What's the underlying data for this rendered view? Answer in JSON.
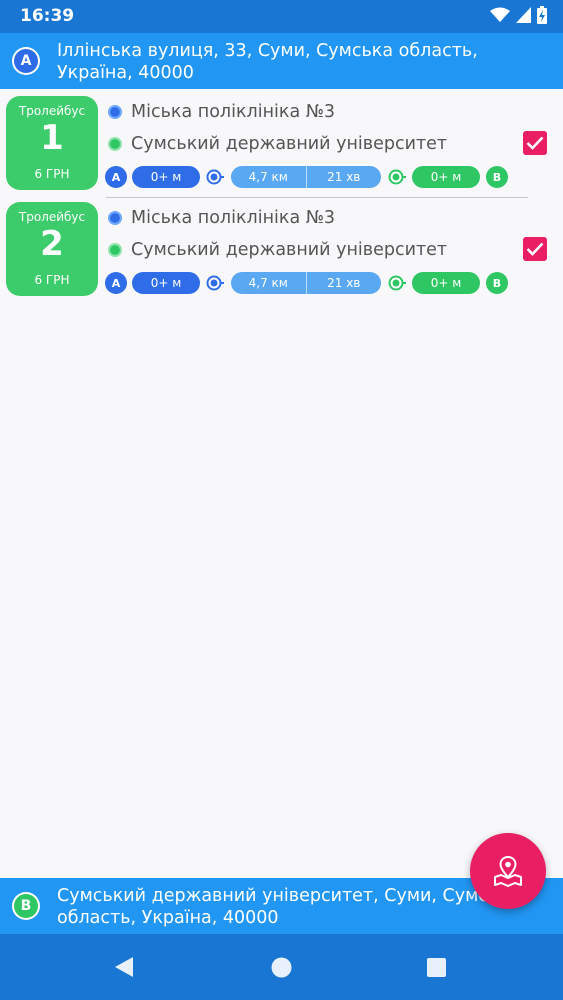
{
  "status_bar": {
    "time": "16:39"
  },
  "origin": {
    "marker": "A",
    "address": "Іллінська вулиця, 33, Суми, Сумська область, Україна, 40000"
  },
  "routes": [
    {
      "type": "Тролейбус",
      "number": "1",
      "price": "6 ГРН",
      "from_stop": "Міська поліклініка №3",
      "to_stop": "Сумський державний університет",
      "checked": true,
      "walk_to_stop": "0+ м",
      "distance": "4,7 км",
      "duration": "21 хв",
      "walk_from_stop": "0+ м",
      "start_marker": "A",
      "end_marker": "B"
    },
    {
      "type": "Тролейбус",
      "number": "2",
      "price": "6 ГРН",
      "from_stop": "Міська поліклініка №3",
      "to_stop": "Сумський державний університет",
      "checked": true,
      "walk_to_stop": "0+ м",
      "distance": "4,7 км",
      "duration": "21 хв",
      "walk_from_stop": "0+ м",
      "start_marker": "A",
      "end_marker": "B"
    }
  ],
  "destination": {
    "marker": "B",
    "address": "Сумський державний університет, Суми, Сумська область, Україна, 40000"
  },
  "colors": {
    "primary": "#2196f3",
    "primary_dark": "#1976d2",
    "badge_green": "#3ccc6c",
    "accent_pink": "#e91e63",
    "stop_blue": "#2f6de8",
    "stop_green": "#2fc764"
  },
  "icons": {
    "status": [
      "wifi-icon",
      "cellular-icon",
      "battery-icon"
    ],
    "fab": "map-pin-icon",
    "nav": [
      "back-icon",
      "home-icon",
      "recents-icon"
    ]
  }
}
